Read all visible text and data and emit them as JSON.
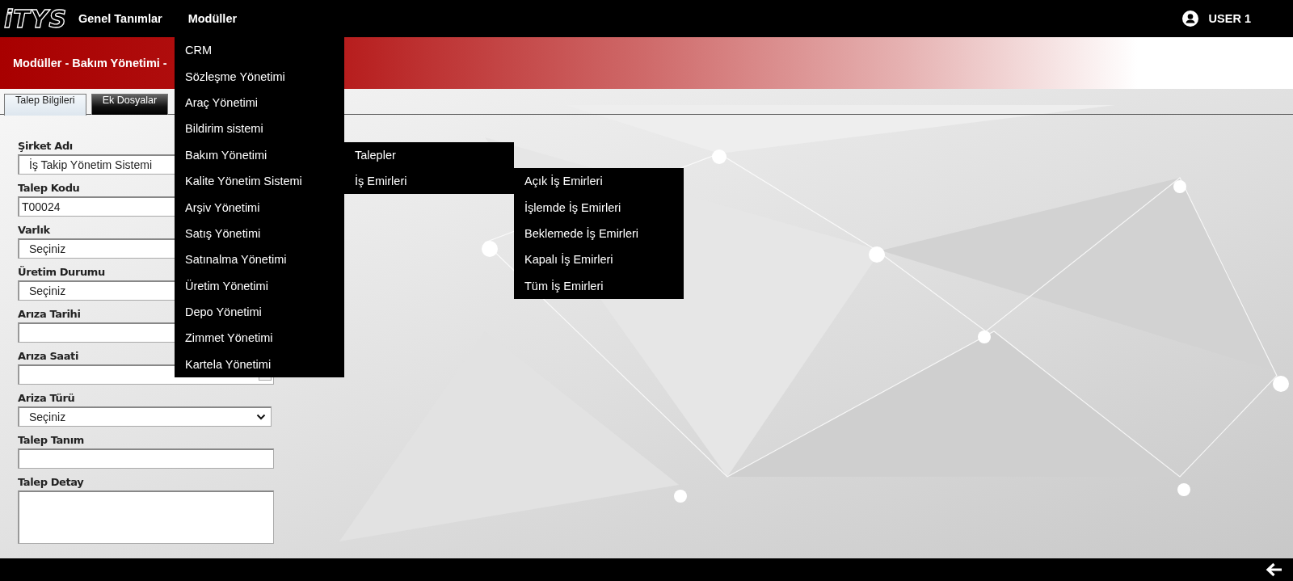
{
  "topbar": {
    "logo": "iTYS",
    "nav": [
      {
        "label": "Genel Tanımlar"
      },
      {
        "label": "Modüller"
      }
    ],
    "user": "USER 1"
  },
  "banner": {
    "title": "Modüller - Bakım Yönetimi -"
  },
  "tabs": [
    {
      "label": "Talep Bilgileri",
      "selected": true
    },
    {
      "label": "Ek Dosyalar",
      "selected": false
    }
  ],
  "form": {
    "fields": [
      {
        "label": "Şirket Adı",
        "kind": "select",
        "value": "İş Takip Yönetim Sistemi"
      },
      {
        "label": "Talep Kodu",
        "kind": "text",
        "value": "T00024"
      },
      {
        "label": "Varlık",
        "kind": "select",
        "value": "Seçiniz"
      },
      {
        "label": "Üretim Durumu",
        "kind": "select",
        "value": "Seçiniz"
      },
      {
        "label": "Arıza Tarihi",
        "kind": "text"
      },
      {
        "label": "Arıza Saati",
        "kind": "time"
      },
      {
        "label": "Ariza Türü",
        "kind": "dropdown",
        "value": "Seçiniz"
      },
      {
        "label": "Talep Tanım",
        "kind": "text"
      },
      {
        "label": "Talep Detay",
        "kind": "textarea"
      }
    ]
  },
  "menu": {
    "items": [
      {
        "label": "CRM"
      },
      {
        "label": "Sözleşme Yönetimi"
      },
      {
        "label": "Araç Yönetimi"
      },
      {
        "label": "Bildirim sistemi"
      },
      {
        "label": "Bakım Yönetimi",
        "children": [
          {
            "label": "Talepler"
          },
          {
            "label": "İş Emirleri",
            "children": [
              {
                "label": "Açık İş Emirleri"
              },
              {
                "label": "İşlemde İş Emirleri"
              },
              {
                "label": "Beklemede İş Emirleri"
              },
              {
                "label": "Kapalı İş Emirleri"
              },
              {
                "label": "Tüm İş Emirleri"
              }
            ]
          }
        ]
      },
      {
        "label": "Kalite Yönetim Sistemi"
      },
      {
        "label": "Arşiv Yönetimi"
      },
      {
        "label": "Satış Yönetimi"
      },
      {
        "label": "Satınalma Yönetimi"
      },
      {
        "label": "Üretim Yönetimi"
      },
      {
        "label": "Depo Yönetimi"
      },
      {
        "label": "Zimmet Yönetimi"
      },
      {
        "label": "Kartela Yönetimi"
      }
    ]
  }
}
